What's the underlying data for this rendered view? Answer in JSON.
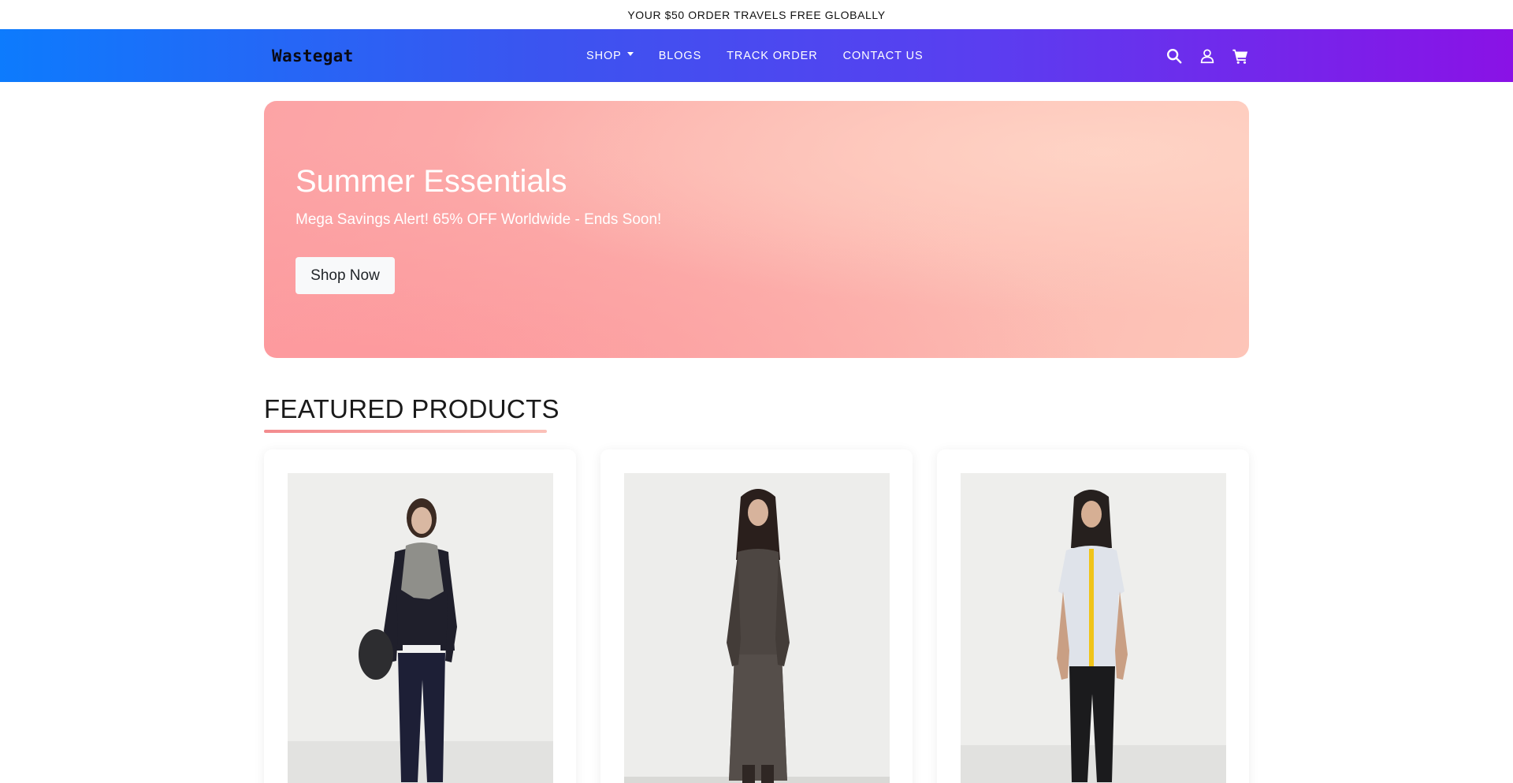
{
  "announcement": {
    "text": "YOUR $50 ORDER TRAVELS FREE GLOBALLY"
  },
  "header": {
    "logo": "Wastegat",
    "nav": [
      {
        "label": "SHOP",
        "has_dropdown": true
      },
      {
        "label": "BLOGS",
        "has_dropdown": false
      },
      {
        "label": "TRACK ORDER",
        "has_dropdown": false
      },
      {
        "label": "CONTACT US",
        "has_dropdown": false
      }
    ],
    "icons": [
      "search-icon",
      "user-icon",
      "cart-icon"
    ],
    "gradient_colors": [
      "#0d7bfd",
      "#8a12e6"
    ]
  },
  "hero": {
    "title": "Summer Essentials",
    "subtitle": "Mega Savings Alert! 65% OFF Worldwide - Ends Soon!",
    "button_label": "Shop Now",
    "gradient_colors": [
      "#fca3a5",
      "#fdc5b8"
    ]
  },
  "featured": {
    "title": "FEATURED PRODUCTS",
    "products": [
      {
        "image": "model-black-jacket-scarf"
      },
      {
        "image": "model-sheer-brown-dress"
      },
      {
        "image": "model-sheer-white-shirt-black-pants"
      }
    ]
  }
}
